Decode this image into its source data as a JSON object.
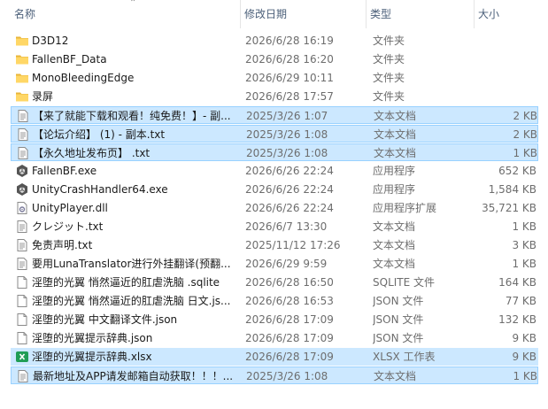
{
  "columns": {
    "name": "名称",
    "date": "修改日期",
    "type": "类型",
    "size": "大小"
  },
  "rows": [
    {
      "name": "D3D12",
      "date": "2026/6/28 16:19",
      "type": "文件夹",
      "size": "",
      "icon": "folder-icon"
    },
    {
      "name": "FallenBF_Data",
      "date": "2026/6/28 16:20",
      "type": "文件夹",
      "size": "",
      "icon": "folder-icon"
    },
    {
      "name": "MonoBleedingEdge",
      "date": "2026/6/29 10:11",
      "type": "文件夹",
      "size": "",
      "icon": "folder-icon"
    },
    {
      "name": "录屏",
      "date": "2026/6/28 17:57",
      "type": "文件夹",
      "size": "",
      "icon": "folder-icon"
    },
    {
      "name": "【来了就能下载和观看！纯免费！】- 副...",
      "date": "2025/3/26 1:07",
      "type": "文本文档",
      "size": "2 KB",
      "icon": "text-file-icon"
    },
    {
      "name": "【论坛介绍】 (1) - 副本.txt",
      "date": "2025/3/26 1:08",
      "type": "文本文档",
      "size": "2 KB",
      "icon": "text-file-icon"
    },
    {
      "name": "【永久地址发布页】 .txt",
      "date": "2025/3/26 1:08",
      "type": "文本文档",
      "size": "1 KB",
      "icon": "text-file-icon"
    },
    {
      "name": "FallenBF.exe",
      "date": "2026/6/26 22:24",
      "type": "应用程序",
      "size": "652 KB",
      "icon": "unity-app-icon"
    },
    {
      "name": "UnityCrashHandler64.exe",
      "date": "2026/6/26 22:24",
      "type": "应用程序",
      "size": "1,584 KB",
      "icon": "unity-app-icon"
    },
    {
      "name": "UnityPlayer.dll",
      "date": "2026/6/26 22:24",
      "type": "应用程序扩展",
      "size": "35,721 KB",
      "icon": "dll-file-icon"
    },
    {
      "name": "クレジット.txt",
      "date": "2026/6/7 13:30",
      "type": "文本文档",
      "size": "1 KB",
      "icon": "text-file-icon"
    },
    {
      "name": "免责声明.txt",
      "date": "2025/11/12 17:26",
      "type": "文本文档",
      "size": "3 KB",
      "icon": "text-file-icon"
    },
    {
      "name": "要用LunaTranslator进行外挂翻译(预翻...",
      "date": "2026/6/29 9:59",
      "type": "文本文档",
      "size": "1 KB",
      "icon": "text-file-icon"
    },
    {
      "name": "淫堕的光翼 悄然逼近的肛虐洗脑 .sqlite",
      "date": "2026/6/28 16:50",
      "type": "SQLITE 文件",
      "size": "164 KB",
      "icon": "generic-file-icon"
    },
    {
      "name": "淫堕的光翼 悄然逼近的肛虐洗脑 日文.js...",
      "date": "2026/6/28 16:53",
      "type": "JSON 文件",
      "size": "77 KB",
      "icon": "generic-file-icon"
    },
    {
      "name": "淫堕的光翼 中文翻译文件.json",
      "date": "2026/6/28 17:09",
      "type": "JSON 文件",
      "size": "132 KB",
      "icon": "generic-file-icon"
    },
    {
      "name": "淫堕的光翼提示辞典.json",
      "date": "2026/6/28 17:09",
      "type": "JSON 文件",
      "size": "9 KB",
      "icon": "generic-file-icon"
    },
    {
      "name": "淫堕的光翼提示辞典.xlsx",
      "date": "2026/6/28 17:09",
      "type": "XLSX 工作表",
      "size": "9 KB",
      "icon": "excel-file-icon"
    },
    {
      "name": "最新地址及APP请发邮箱自动获取！！！...",
      "date": "2025/3/26 1:08",
      "type": "文本文档",
      "size": "1 KB",
      "icon": "text-file-icon"
    }
  ],
  "selected_rows": [
    4,
    5,
    6,
    17,
    18
  ],
  "focused_rows": [
    4,
    5,
    6,
    18
  ],
  "colors": {
    "selection": "#cce8ff",
    "focus_border": "#99d1ff",
    "header_text": "#4c607a",
    "detail_text": "#6d6d6d"
  }
}
